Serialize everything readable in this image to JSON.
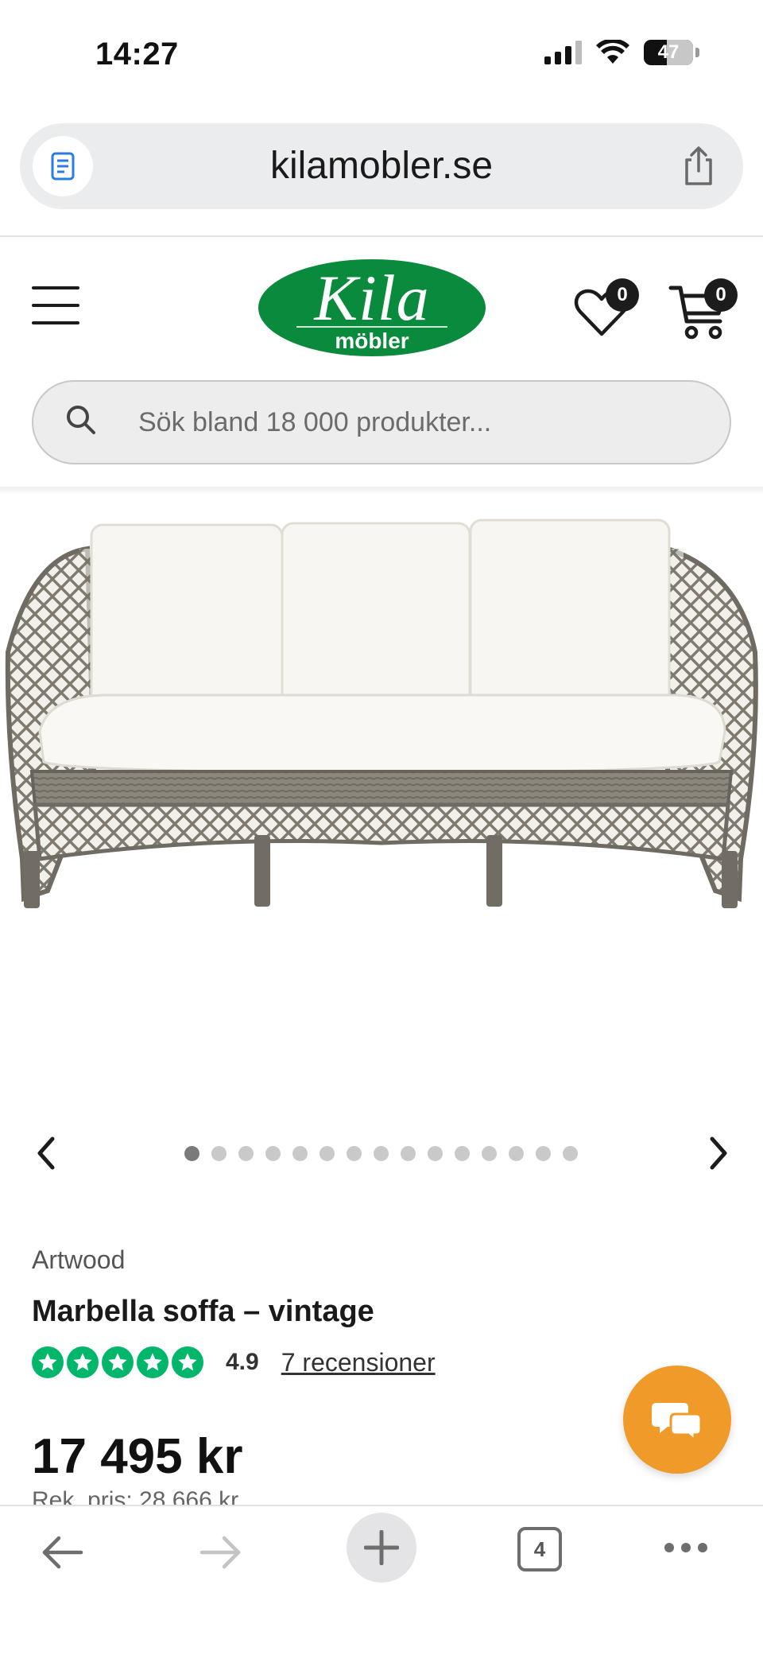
{
  "status_bar": {
    "time": "14:27",
    "battery_level": "47"
  },
  "browser": {
    "url": "kilamobler.se",
    "open_tabs": "4"
  },
  "header": {
    "logo_main": "Kila",
    "logo_sub": "möbler",
    "wishlist_count": "0",
    "cart_count": "0",
    "brand_color": "#0a8a3c"
  },
  "search": {
    "placeholder": "Sök bland 18 000 produkter..."
  },
  "carousel": {
    "total_images": 15,
    "active_index": 0
  },
  "product": {
    "brand": "Artwood",
    "name": "Marbella soffa – vintage",
    "rating": "4.9",
    "rating_stars": 5,
    "reviews_text": "7 recensioner",
    "price": "17 495 kr",
    "recommended_price": "Rek. pris: 28 666 kr",
    "star_color": "#00b66b"
  },
  "chat": {
    "color": "#f09a2a"
  }
}
